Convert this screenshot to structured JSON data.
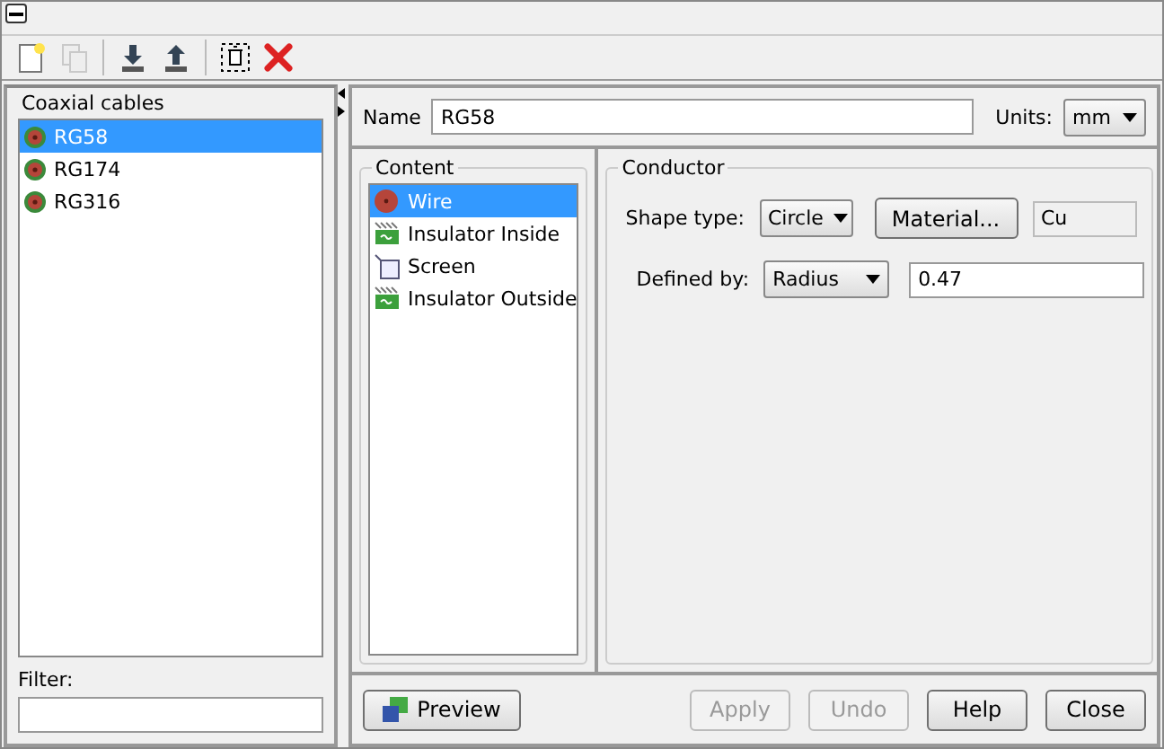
{
  "toolbar": [
    {
      "kind": "new",
      "disabled": false
    },
    {
      "kind": "copy",
      "disabled": true
    },
    {
      "kind": "import",
      "disabled": false
    },
    {
      "kind": "export",
      "disabled": false
    },
    {
      "kind": "delete-dashed",
      "disabled": false
    },
    {
      "kind": "remove",
      "disabled": false
    }
  ],
  "cables": {
    "title": "Coaxial cables",
    "items": [
      {
        "label": "RG58",
        "selected": true
      },
      {
        "label": "RG174",
        "selected": false
      },
      {
        "label": "RG316",
        "selected": false
      }
    ],
    "filter_label": "Filter:"
  },
  "name_row": {
    "label": "Name",
    "value": "RG58",
    "units_label": "Units:",
    "units": "mm"
  },
  "content": {
    "title": "Content",
    "items": [
      {
        "label": "Wire",
        "kind": "wire",
        "selected": true
      },
      {
        "label": "Insulator Inside",
        "kind": "insulator",
        "selected": false
      },
      {
        "label": "Screen",
        "kind": "screen",
        "selected": false
      },
      {
        "label": "Insulator Outside",
        "kind": "insulator",
        "selected": false
      }
    ]
  },
  "conductor": {
    "title": "Conductor",
    "shape_label": "Shape type:",
    "shape": "Circle",
    "material_button": "Material...",
    "material": "Cu",
    "defined_label": "Defined by:",
    "defined": "Radius",
    "value": "0.47"
  },
  "buttons": [
    {
      "label": "Preview",
      "kind": "preview",
      "disabled": false
    },
    {
      "label": "Apply",
      "kind": "plain",
      "disabled": true
    },
    {
      "label": "Undo",
      "kind": "plain",
      "disabled": true
    },
    {
      "label": "Help",
      "kind": "plain",
      "disabled": false
    },
    {
      "label": "Close",
      "kind": "plain",
      "disabled": false
    }
  ]
}
